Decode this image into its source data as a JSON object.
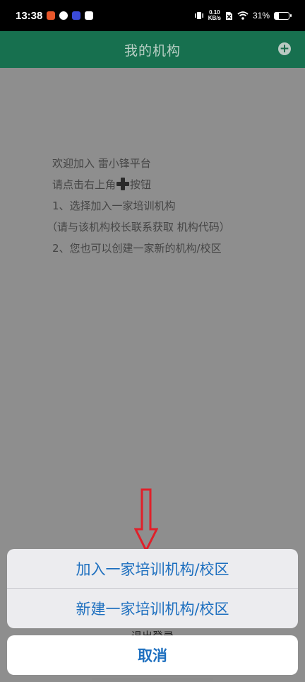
{
  "status_bar": {
    "time": "13:38",
    "net_speed_value": "0.10",
    "net_speed_unit": "KB/s",
    "battery": "31%",
    "battery_level": 0.31
  },
  "header": {
    "title": "我的机构",
    "add_icon": "plus-circle-icon"
  },
  "intro": {
    "line1": "欢迎加入 雷小锋平台",
    "line2_before": "请点击右上角",
    "line2_after": "按钮",
    "line3": "1、选择加入一家培训机构",
    "line4": "（请与该机构校长联系获取 机构代码）",
    "line5": "2、您也可以创建一家新的机构/校区"
  },
  "action_sheet": {
    "option_join": "加入一家培训机构/校区",
    "option_create": "新建一家培训机构/校区",
    "hidden_option": "退出登录",
    "cancel": "取消"
  },
  "colors": {
    "header_bg": "#17704f",
    "overlay": "#8e8e8e",
    "action_text": "#1d6fbf",
    "arrow": "#e0202a"
  }
}
